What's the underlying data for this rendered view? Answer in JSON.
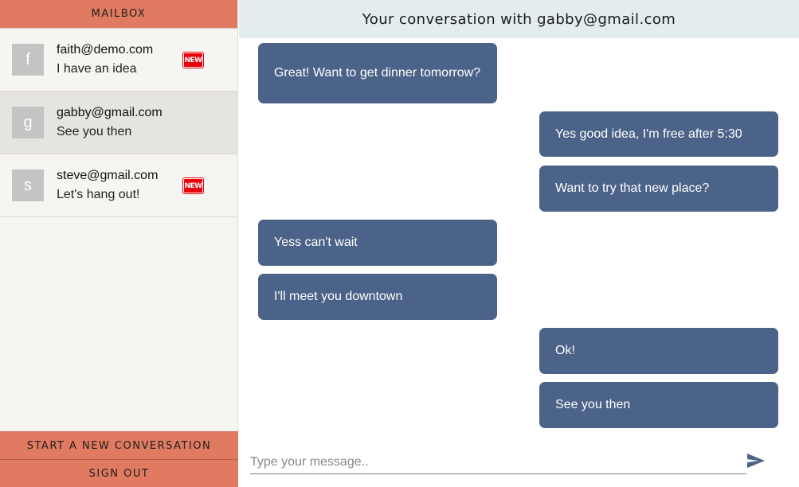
{
  "sidebar": {
    "title": "MAILBOX",
    "conversations": [
      {
        "avatar_letter": "f",
        "email": "faith@demo.com",
        "preview": "I have an idea",
        "badge": "NEW"
      },
      {
        "avatar_letter": "g",
        "email": "gabby@gmail.com",
        "preview": "See you then",
        "badge": ""
      },
      {
        "avatar_letter": "s",
        "email": "steve@gmail.com",
        "preview": "Let's hang out!",
        "badge": "NEW"
      }
    ],
    "new_conversation_label": "START A NEW CONVERSATION",
    "sign_out_label": "SIGN OUT"
  },
  "main": {
    "header_title": "Your conversation with gabby@gmail.com",
    "messages": [
      {
        "from": "them",
        "text": "Great! Want to get dinner tomorrow?"
      },
      {
        "from": "me",
        "text": "Yes good idea, I'm free after 5:30"
      },
      {
        "from": "me",
        "text": "Want to try that new place?"
      },
      {
        "from": "them",
        "text": "Yess can't wait"
      },
      {
        "from": "them",
        "text": "I'll meet you downtown"
      },
      {
        "from": "me",
        "text": "Ok!"
      },
      {
        "from": "me",
        "text": "See you then"
      }
    ],
    "composer": {
      "placeholder": "Type your message..",
      "value": ""
    }
  },
  "colors": {
    "accent": "#e07a61",
    "bubble": "#4b6389",
    "header_bg": "#e3edef",
    "badge": "#e8000b"
  },
  "icons": {
    "send": "send-icon"
  }
}
